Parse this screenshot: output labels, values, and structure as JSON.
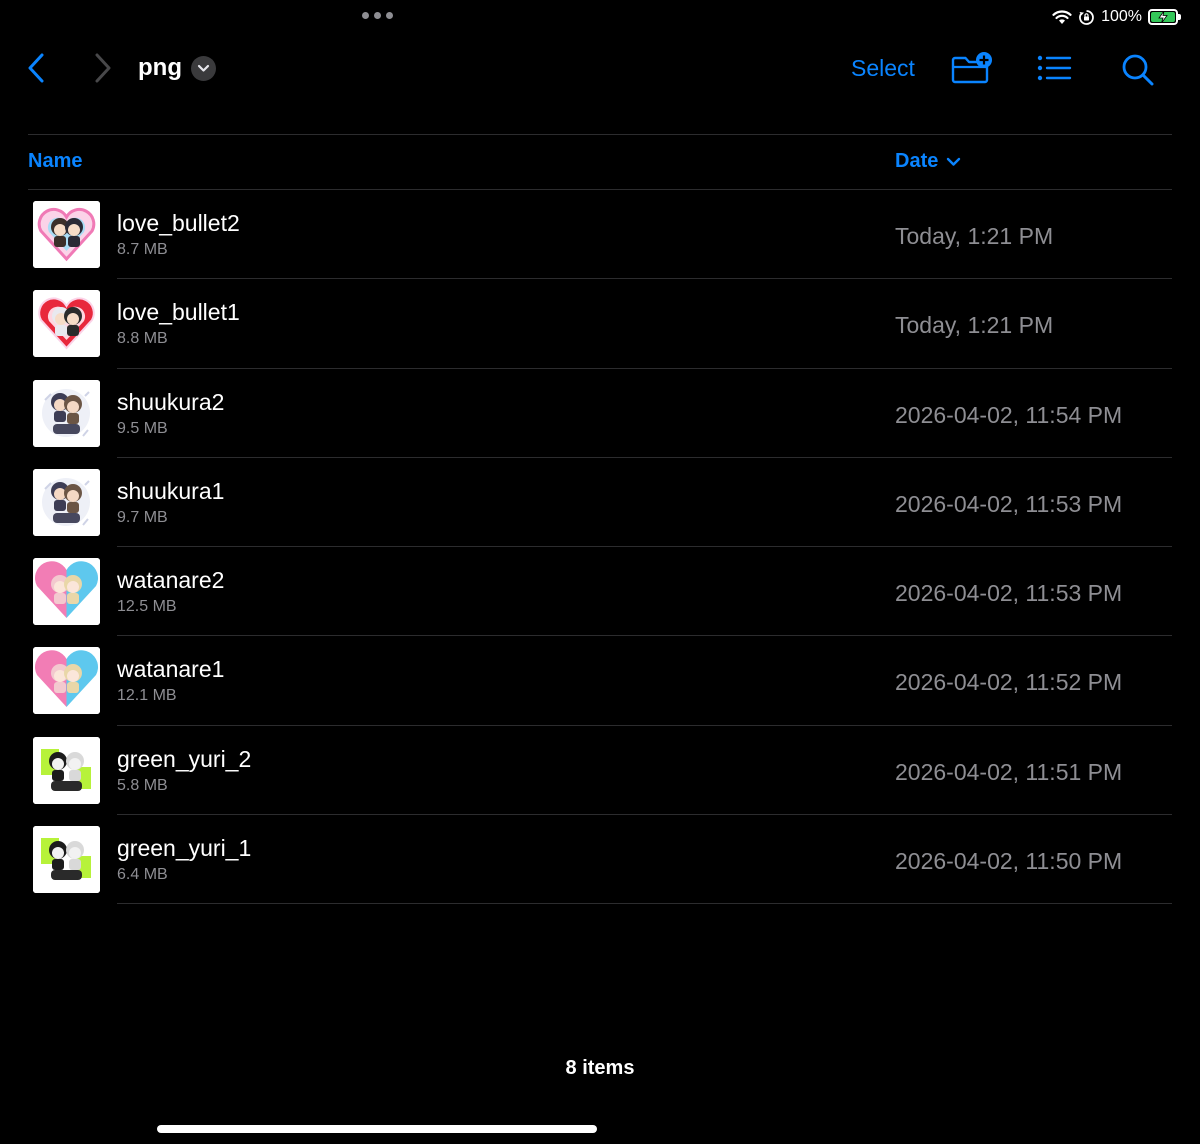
{
  "status_bar": {
    "battery_percent": "100%",
    "battery_level": 1.0,
    "battery_color": "#34c759",
    "icons": [
      "wifi-icon",
      "orientation-lock-icon",
      "battery-charging-icon"
    ]
  },
  "nav": {
    "title": "png",
    "select_label": "Select",
    "icons": [
      "back-chevron-icon",
      "forward-chevron-icon",
      "title-chevron-down-icon",
      "new-folder-icon",
      "list-view-icon",
      "search-icon"
    ]
  },
  "columns": {
    "name_label": "Name",
    "date_label": "Date"
  },
  "files": [
    {
      "name": "love_bullet2",
      "size": "8.7 MB",
      "date": "Today, 1:21 PM",
      "thumb": "heart-pink-blue"
    },
    {
      "name": "love_bullet1",
      "size": "8.8 MB",
      "date": "Today, 1:21 PM",
      "thumb": "heart-red"
    },
    {
      "name": "shuukura2",
      "size": "9.5 MB",
      "date": "2026-04-02, 11:54 PM",
      "thumb": "chibi-dark"
    },
    {
      "name": "shuukura1",
      "size": "9.7 MB",
      "date": "2026-04-02, 11:53 PM",
      "thumb": "chibi-dark"
    },
    {
      "name": "watanare2",
      "size": "12.5 MB",
      "date": "2026-04-02, 11:53 PM",
      "thumb": "heart-pink-cyan"
    },
    {
      "name": "watanare1",
      "size": "12.1 MB",
      "date": "2026-04-02, 11:52 PM",
      "thumb": "heart-pink-cyan"
    },
    {
      "name": "green_yuri_2",
      "size": "5.8 MB",
      "date": "2026-04-02, 11:51 PM",
      "thumb": "chibi-green"
    },
    {
      "name": "green_yuri_1",
      "size": "6.4 MB",
      "date": "2026-04-02, 11:50 PM",
      "thumb": "chibi-green"
    }
  ],
  "footer": {
    "item_count": "8 items"
  },
  "colors": {
    "accent": "#0a84ff",
    "background": "#000000",
    "secondary_text": "#8e8e93",
    "separator": "#2c2c2e"
  }
}
